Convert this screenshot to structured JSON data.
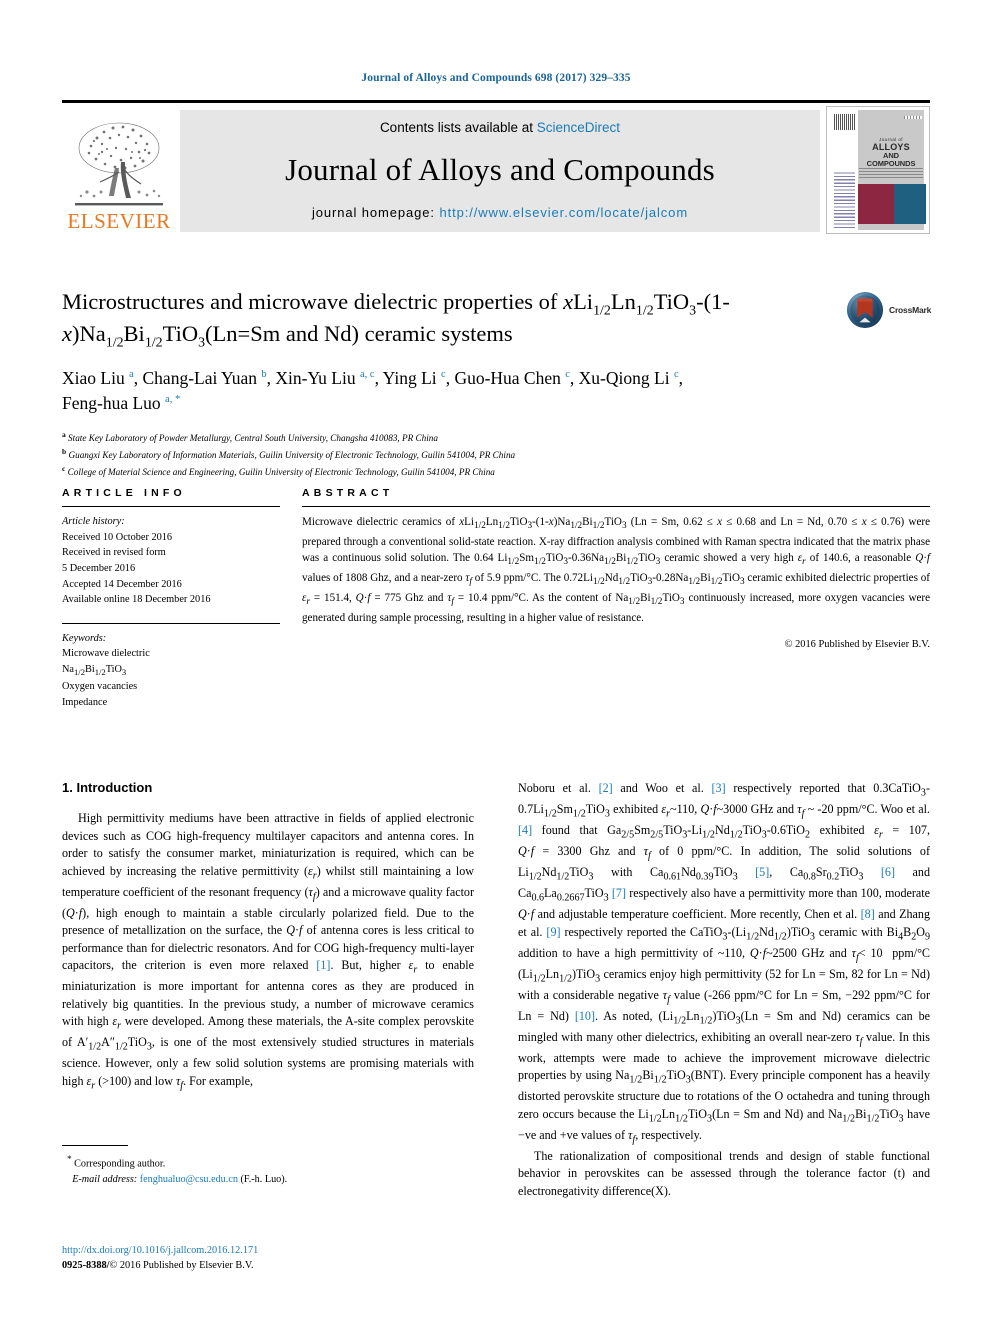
{
  "running_head": "Journal of Alloys and Compounds 698 (2017) 329–335",
  "masthead": {
    "contents_prefix": "Contents lists available at ",
    "contents_link": "ScienceDirect",
    "journal_name": "Journal of Alloys and Compounds",
    "homepage_prefix": "journal homepage: ",
    "homepage_url": "http://www.elsevier.com/locate/jalcom",
    "publisher_logo_text": "ELSEVIER",
    "cover": {
      "line1": "Journal of",
      "line2": "ALLOYS",
      "line3": "AND COMPOUNDS"
    }
  },
  "article": {
    "title_line1_a": "Microstructures and microwave dielectric properties of ",
    "title_x1": "x",
    "title_li": "Li",
    "title_sub_half1": "1/2",
    "title_ln": "Ln",
    "title_sub_half2": "1/",
    "title_line2_a": "2",
    "title_line2_b": "TiO",
    "title_sub3": "3",
    "title_line2_c": "-(1-",
    "title_x2": "x",
    "title_line2_d": ")Na",
    "title_sub_half3": "1/2",
    "title_bi": "Bi",
    "title_sub_half4": "1/2",
    "title_tio3b": "TiO",
    "title_sub3b": "3",
    "title_line2_e": "(Ln=Sm and Nd) ceramic systems",
    "authors": [
      {
        "name": "Xiao Liu",
        "marks": "a"
      },
      {
        "name": "Chang-Lai Yuan",
        "marks": "b"
      },
      {
        "name": "Xin-Yu Liu",
        "marks": "a, c"
      },
      {
        "name": "Ying Li",
        "marks": "c"
      },
      {
        "name": "Guo-Hua Chen",
        "marks": "c"
      },
      {
        "name": "Xu-Qiong Li",
        "marks": "c"
      },
      {
        "name": "Feng-hua Luo",
        "marks": "a, *"
      }
    ],
    "affiliations": [
      {
        "label": "a",
        "text": "State Key Laboratory of Powder Metallurgy, Central South University, Changsha 410083, PR China"
      },
      {
        "label": "b",
        "text": "Guangxi Key Laboratory of Information Materials, Guilin University of Electronic Technology, Guilin 541004, PR China"
      },
      {
        "label": "c",
        "text": "College of Material Science and Engineering, Guilin University of Electronic Technology, Guilin 541004, PR China"
      }
    ],
    "crossmark_label": "CrossMark"
  },
  "article_info": {
    "heading": "ARTICLE INFO",
    "history_label": "Article history:",
    "history": [
      "Received 10 October 2016",
      "Received in revised form",
      "5 December 2016",
      "Accepted 14 December 2016",
      "Available online 18 December 2016"
    ],
    "keywords_label": "Keywords:",
    "keywords": [
      "Microwave dielectric",
      "Na1/2Bi1/2TiO3",
      "Oxygen vacancies",
      "Impedance"
    ]
  },
  "abstract": {
    "heading": "ABSTRACT",
    "text": "Microwave dielectric ceramics of xLi1/2Ln1/2TiO3-(1-x)Na1/2Bi1/2TiO3 (Ln = Sm, 0.62 ≤ x ≤ 0.68 and Ln = Nd, 0.70 ≤ x ≤ 0.76) were prepared through a conventional solid-state reaction. X-ray diffraction analysis combined with Raman spectra indicated that the matrix phase was a continuous solid solution. The 0.64 Li1/2Sm1/2TiO3-0.36Na1/2Bi1/2TiO3 ceramic showed a very high εr of 140.6, a reasonable Q·f values of 1808 Ghz, and a near-zero τf of 5.9 ppm/°C. The 0.72Li1/2Nd1/2TiO3-0.28Na1/2Bi1/2TiO3 ceramic exhibited dielectric properties of εr = 151.4, Q·f = 775 Ghz and τf = 10.4 ppm/°C. As the content of Na1/2Bi1/2TiO3 continuously increased, more oxygen vacancies were generated during sample processing, resulting in a higher value of resistance.",
    "copyright": "© 2016 Published by Elsevier B.V."
  },
  "body": {
    "section_heading": "1. Introduction",
    "left_paragraph_1": "High permittivity mediums have been attractive in fields of applied electronic devices such as COG high-frequency multilayer capacitors and antenna cores. In order to satisfy the consumer market, miniaturization is required, which can be achieved by increasing the relative permittivity (εr) whilst still maintaining a low temperature coefficient of the resonant frequency (τf) and a microwave quality factor (Q·f), high enough to maintain a stable circularly polarized field. Due to the presence of metallization on the surface, the Q·f of antenna cores is less critical to performance than for dielectric resonators. And for COG high-frequency multi-layer capacitors, the criterion is even more relaxed [1]. But, higher εr to enable miniaturization is more important for antenna cores as they are produced in relatively big quantities. In the previous study, a number of microwave ceramics with high εr were developed. Among these materials, the A-site complex perovskite of A'1/2A''1/2TiO3, is one of the most extensively studied structures in materials science. However, only a few solid solution systems are promising materials with high εr (>100) and low τf. For example,",
    "right_paragraph_1": "Noboru et al. [2] and Woo et al. [3] respectively reported that 0.3CaTiO3-0.7Li1/2Sm1/2TiO3 exhibited εr~110, Q·f~3000 GHz and τf ~ -20 ppm/°C. Woo et al. [4] found that Ga2/5Sm2/5TiO3-Li1/2Nd1/2TiO3-0.6TiO2 exhibited εr = 107, Q·f = 3300 Ghz and τf of 0 ppm/°C. In addition, The solid solutions of Li1/2Nd1/2TiO3 with Ca0.61Nd0.39TiO3 [5], Ca0.8Sr0.2TiO3 [6] and Ca0.6La0.2667TiO3 [7] respectively also have a permittivity more than 100, moderate Q·f and adjustable temperature coefficient. More recently, Chen et al. [8] and Zhang et al. [9] respectively reported the CaTiO3-(Li1/2Nd1/2)TiO3 ceramic with Bi4B2O9 addition to have a high permittivity of ~110, Q·f~2500 GHz and τf < 10 ppm/°C (Li1/2Ln1/2)TiO3 ceramics enjoy high permittivity (52 for Ln = Sm, 82 for Ln = Nd) with a considerable negative τf value (-266 ppm/°C for Ln = Sm, −292 ppm/°C for Ln = Nd) [10]. As noted, (Li1/2Ln1/2)TiO3(Ln = Sm and Nd) ceramics can be mingled with many other dielectrics, exhibiting an overall near-zero τf value. In this work, attempts were made to achieve the improvement microwave dielectric properties by using Na1/2Bi1/2TiO3(BNT). Every principle component has a heavily distorted perovskite structure due to rotations of the O octahedra and tuning through zero occurs because the Li1/2Ln1/2TiO3(Ln = Sm and Nd) and Na1/2Bi1/2TiO3 have −ve and +ve values of τf, respectively.",
    "right_paragraph_2": "The rationalization of compositional trends and design of stable functional behavior in perovskites can be assessed through the tolerance factor (t) and electronegativity difference(X)."
  },
  "footnote": {
    "star": "*",
    "corresponding": "Corresponding author.",
    "email_label": "E-mail address:",
    "email": "fenghualuo@csu.edu.cn",
    "email_suffix": "(F.-h. Luo)."
  },
  "footer": {
    "doi": "http://dx.doi.org/10.1016/j.jallcom.2016.12.171",
    "issn": "0925-8388/",
    "issn_rest": "© 2016 Published by Elsevier B.V."
  }
}
